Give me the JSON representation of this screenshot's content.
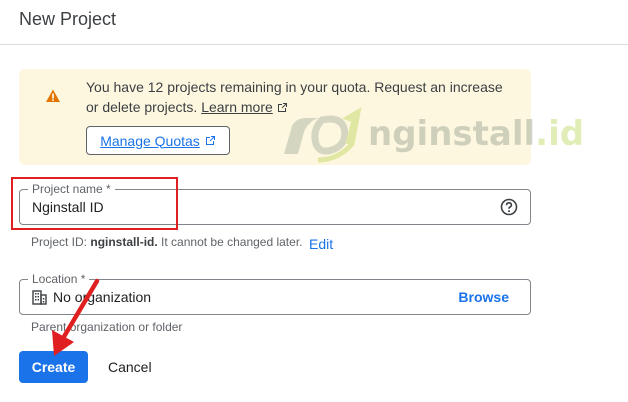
{
  "header": {
    "title": "New Project"
  },
  "alert": {
    "message": "You have 12 projects remaining in your quota. Request an increase or delete projects.",
    "learn_more": "Learn more",
    "manage_quotas": "Manage Quotas",
    "icon": "warning-icon",
    "color": "#fef7e0"
  },
  "watermark": {
    "text": "nginstall",
    "suffix": ".id"
  },
  "project_name": {
    "label": "Project name *",
    "value": "Nginstall ID",
    "icon": "help-circle-icon"
  },
  "project_id": {
    "prefix": "Project ID:",
    "id": "nginstall-id.",
    "suffix": "It cannot be changed later.",
    "edit": "Edit"
  },
  "location": {
    "label": "Location *",
    "value": "No organization",
    "browse": "Browse",
    "hint": "Parent organization or folder",
    "icon": "organization-icon"
  },
  "actions": {
    "create": "Create",
    "cancel": "Cancel",
    "primary_color": "#1a73e8"
  },
  "annotation_color": "#e02020"
}
